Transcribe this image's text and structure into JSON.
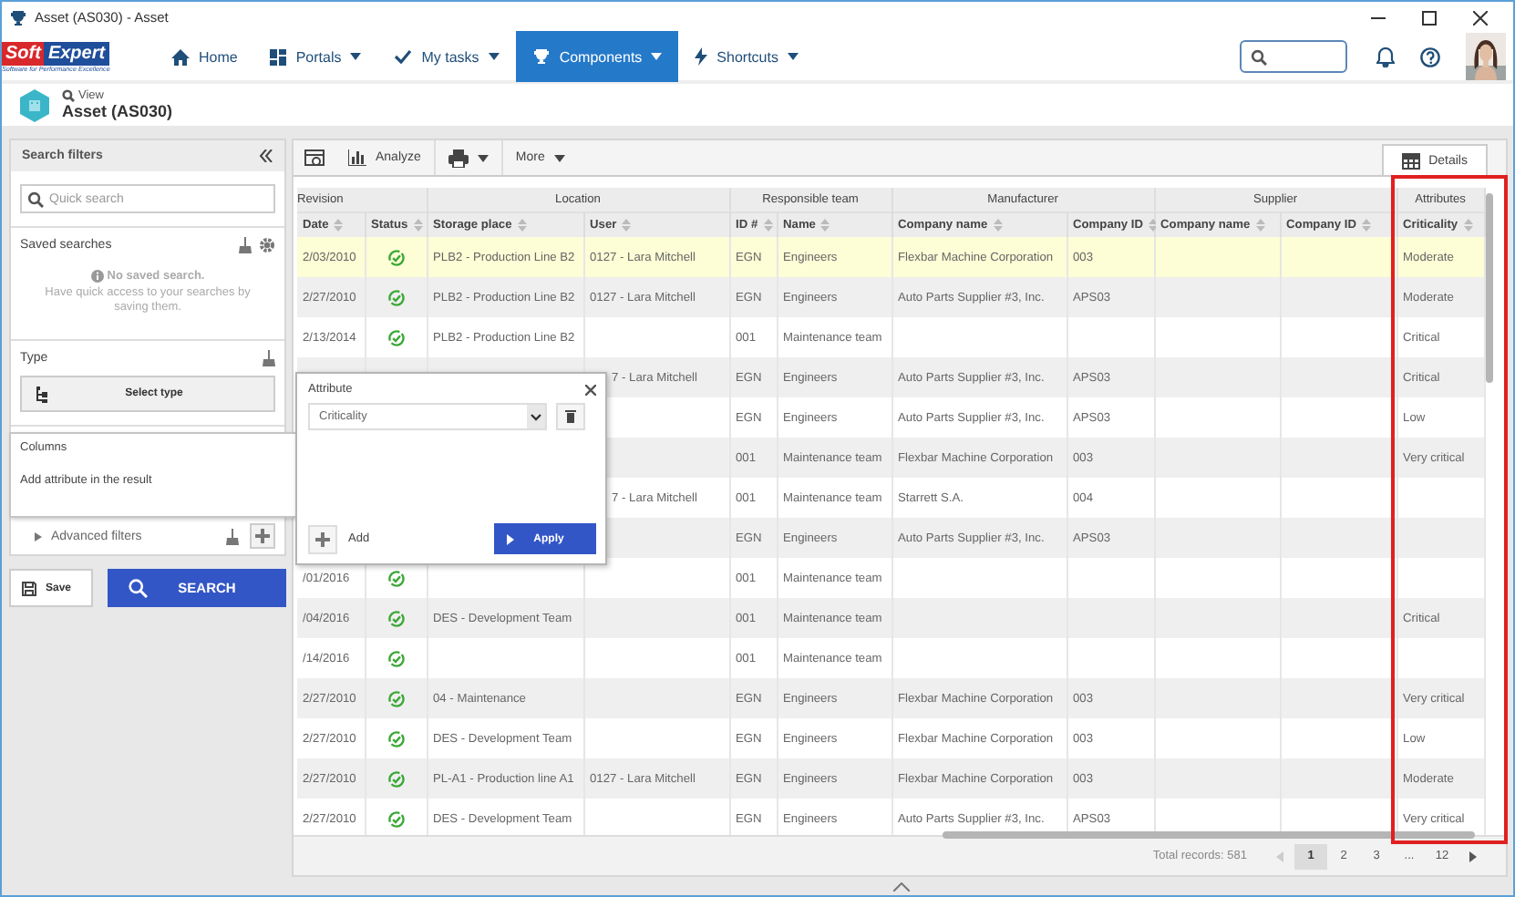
{
  "window": {
    "title": "Asset (AS030) - Asset"
  },
  "nav": {
    "logo": {
      "word_1": "Soft",
      "word_2": "Expert",
      "tagline": "Software for Performance Excellence"
    },
    "items": [
      {
        "label": "Home",
        "has_menu": false,
        "selected": false
      },
      {
        "label": "Portals",
        "has_menu": true,
        "selected": false
      },
      {
        "label": "My tasks",
        "has_menu": true,
        "selected": false
      },
      {
        "label": "Components",
        "has_menu": true,
        "selected": true
      },
      {
        "label": "Shortcuts",
        "has_menu": true,
        "selected": false
      }
    ]
  },
  "page_header": {
    "crumb": "View",
    "title": "Asset (AS030)"
  },
  "filters": {
    "title": "Search filters",
    "quick_search": {
      "placeholder": "Quick search"
    },
    "saved": {
      "title": "Saved searches",
      "empty_title": "No saved search.",
      "empty_hint": "Have quick access to your searches by saving them."
    },
    "type": {
      "title": "Type",
      "button": "Select type"
    },
    "advanced": {
      "title": "Advanced filters",
      "expanded": false
    },
    "save": "Save",
    "search": "SEARCH"
  },
  "columns_popup": {
    "title": "Columns",
    "hint": "Add attribute in the result"
  },
  "attribute_popup": {
    "title": "Attribute",
    "select": {
      "value": "Criticality"
    },
    "add": "Add",
    "apply": "Apply"
  },
  "toolbar": {
    "analyze": "Analyze",
    "more": "More",
    "details_tab": "Details"
  },
  "table": {
    "groups": [
      "Revision",
      "Location",
      "Responsible team",
      "Manufacturer",
      "Supplier",
      "Attributes"
    ],
    "columns": [
      "Date",
      "Status",
      "Storage place",
      "User",
      "ID #",
      "Name",
      "Company name",
      "Company ID",
      "Company name",
      "Company ID",
      "Criticality"
    ],
    "rows": [
      {
        "selected": true,
        "status_ok": true,
        "cells": [
          "2/03/2010",
          null,
          "PLB2 - Production Line B2",
          "0127 - Lara Mitchell",
          "EGN",
          "Engineers",
          "Flexbar Machine Corporation",
          "003",
          null,
          null,
          "Moderate"
        ]
      },
      {
        "selected": false,
        "status_ok": true,
        "cells": [
          "2/27/2010",
          null,
          "PLB2 - Production Line B2",
          "0127 - Lara Mitchell",
          "EGN",
          "Engineers",
          "Auto Parts Supplier #3, Inc.",
          "APS03",
          null,
          null,
          "Moderate"
        ]
      },
      {
        "selected": false,
        "status_ok": true,
        "cells": [
          "2/13/2014",
          null,
          "PLB2 - Production Line B2",
          null,
          "001",
          "Maintenance team",
          null,
          null,
          null,
          null,
          "Critical"
        ]
      },
      {
        "selected": false,
        "cells": [
          null,
          null,
          null,
          "7 - Lara Mitchell",
          "EGN",
          "Engineers",
          "Auto Parts Supplier #3, Inc.",
          "APS03",
          null,
          null,
          "Critical"
        ]
      },
      {
        "selected": false,
        "cells": [
          null,
          null,
          null,
          null,
          "EGN",
          "Engineers",
          "Auto Parts Supplier #3, Inc.",
          "APS03",
          null,
          null,
          "Low"
        ]
      },
      {
        "selected": false,
        "cells": [
          null,
          null,
          null,
          null,
          "001",
          "Maintenance team",
          "Flexbar Machine Corporation",
          "003",
          null,
          null,
          "Very critical"
        ]
      },
      {
        "selected": false,
        "cells": [
          null,
          null,
          null,
          "7 - Lara Mitchell",
          "001",
          "Maintenance team",
          "Starrett S.A.",
          "004",
          null,
          null,
          null
        ]
      },
      {
        "selected": false,
        "cells": [
          null,
          null,
          null,
          null,
          "EGN",
          "Engineers",
          "Auto Parts Supplier #3, Inc.",
          "APS03",
          null,
          null,
          null
        ]
      },
      {
        "selected": false,
        "status_ok": true,
        "cells": [
          "/01/2016",
          null,
          null,
          null,
          "001",
          "Maintenance team",
          null,
          null,
          null,
          null,
          null
        ]
      },
      {
        "selected": false,
        "status_ok": true,
        "cells": [
          "/04/2016",
          null,
          "DES - Development Team",
          null,
          "001",
          "Maintenance team",
          null,
          null,
          null,
          null,
          "Critical"
        ]
      },
      {
        "selected": false,
        "status_ok": true,
        "cells": [
          "/14/2016",
          null,
          null,
          null,
          "001",
          "Maintenance team",
          null,
          null,
          null,
          null,
          null
        ]
      },
      {
        "selected": false,
        "status_ok": true,
        "cells": [
          "2/27/2010",
          null,
          "04 - Maintenance",
          null,
          "EGN",
          "Engineers",
          "Flexbar Machine Corporation",
          "003",
          null,
          null,
          "Very critical"
        ]
      },
      {
        "selected": false,
        "status_ok": true,
        "cells": [
          "2/27/2010",
          null,
          "DES - Development Team",
          null,
          "EGN",
          "Engineers",
          "Flexbar Machine Corporation",
          "003",
          null,
          null,
          "Low"
        ]
      },
      {
        "selected": false,
        "status_ok": true,
        "cells": [
          "2/27/2010",
          null,
          "PL-A1 - Production line A1",
          "0127 - Lara Mitchell",
          "EGN",
          "Engineers",
          "Flexbar Machine Corporation",
          "003",
          null,
          null,
          "Moderate"
        ]
      },
      {
        "selected": false,
        "status_ok": true,
        "cells": [
          "2/27/2010",
          null,
          "DES - Development Team",
          null,
          "EGN",
          "Engineers",
          "Auto Parts Supplier #3, Inc.",
          "APS03",
          null,
          null,
          "Very critical"
        ]
      }
    ]
  },
  "pagination": {
    "total": "Total records: 581",
    "prev": {
      "disabled": true
    },
    "next": {
      "disabled": false
    },
    "pages": [
      {
        "label": "1",
        "selected": true
      },
      {
        "label": "2",
        "selected": false
      },
      {
        "label": "3",
        "selected": false
      },
      {
        "label": "...",
        "selected": false
      },
      {
        "label": "12",
        "selected": false
      }
    ]
  }
}
